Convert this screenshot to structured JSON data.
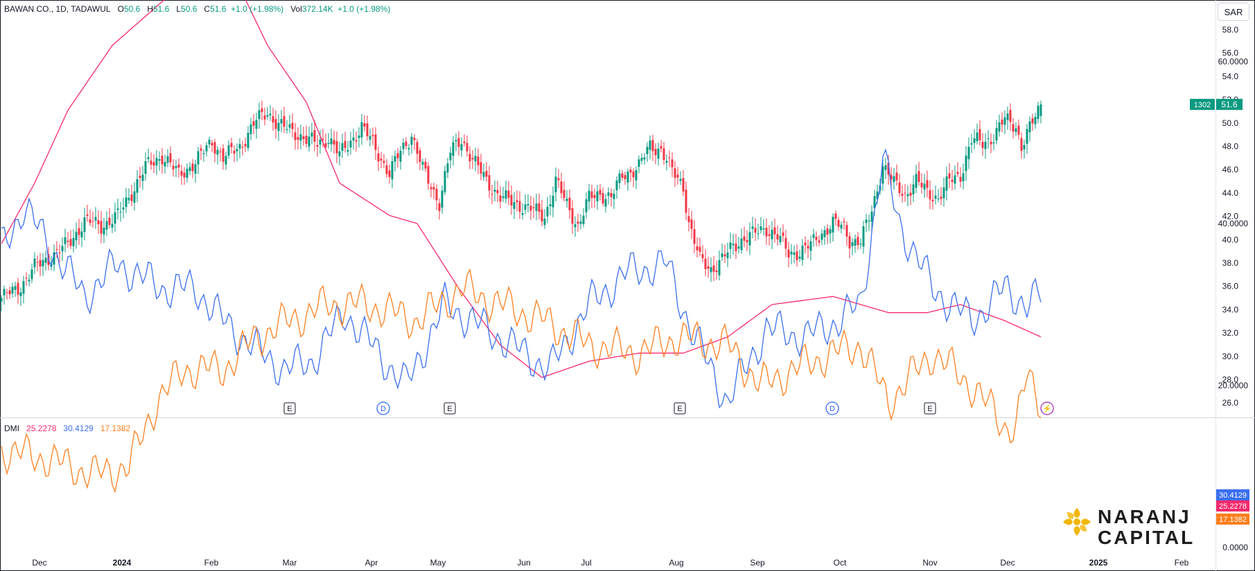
{
  "header": {
    "symbol": "BAWAN CO., 1D, TADAWUL",
    "o_label": "O",
    "o_value": "50.6",
    "h_label": "H",
    "h_value": "51.6",
    "l_label": "L",
    "l_value": "50.6",
    "c_label": "C",
    "c_value": "51.6",
    "change": "+1.0 (+1.98%)",
    "vol_label": "Vol",
    "vol_value": "372.14K",
    "vol_change": "+1.0 (+1.98%)"
  },
  "currency": "SAR",
  "dmi": {
    "label": "DMI",
    "v1": "25.2278",
    "v2": "30.4129",
    "v3": "17.1382"
  },
  "logo": {
    "line1": "NARANJ",
    "line2": "CAPITAL"
  },
  "colors": {
    "up": "#089981",
    "down": "#f23645",
    "adx": "#f7296d",
    "plus_di": "#3a6ff0",
    "minus_di": "#ff7f1e",
    "text": "#131722"
  },
  "chart_data": [
    {
      "type": "candlestick",
      "title": "BAWAN CO., 1D, TADAWUL",
      "y_ticks": [
        "58.0",
        "56.0",
        "54.0",
        "52.0",
        "50.0",
        "48.0",
        "46.0",
        "44.0",
        "42.0",
        "40.0",
        "38.0",
        "36.0",
        "34.0",
        "32.0",
        "30.0",
        "28.0",
        "26.0"
      ],
      "ylim": [
        25.2,
        59.0
      ],
      "x_ticks": [
        "Dec",
        "2024",
        "Feb",
        "Mar",
        "Apr",
        "May",
        "Jun",
        "Jul",
        "Aug",
        "Sep",
        "Oct",
        "Nov",
        "Dec",
        "2025",
        "Feb"
      ],
      "last_price": "51.6",
      "countdown": "1302",
      "close_path": [
        [
          0,
          35.0
        ],
        [
          6,
          35.8
        ],
        [
          12,
          37.6
        ],
        [
          18,
          38.6
        ],
        [
          24,
          39.6
        ],
        [
          30,
          41.6
        ],
        [
          36,
          41.2
        ],
        [
          42,
          42.0
        ],
        [
          48,
          44.5
        ],
        [
          52,
          46.2
        ],
        [
          58,
          47.2
        ],
        [
          64,
          45.6
        ],
        [
          70,
          46.6
        ],
        [
          76,
          48.5
        ],
        [
          80,
          47.0
        ],
        [
          86,
          48.0
        ],
        [
          92,
          50.2
        ],
        [
          96,
          51.0
        ],
        [
          100,
          49.8
        ],
        [
          106,
          49.2
        ],
        [
          110,
          48.6
        ],
        [
          114,
          48.2
        ],
        [
          118,
          48.8
        ],
        [
          122,
          47.2
        ],
        [
          126,
          48.5
        ],
        [
          130,
          49.6
        ],
        [
          134,
          48.3
        ],
        [
          140,
          45.6
        ],
        [
          144,
          47.6
        ],
        [
          148,
          49.0
        ],
        [
          152,
          46.0
        ],
        [
          158,
          43.2
        ],
        [
          162,
          47.5
        ],
        [
          166,
          48.7
        ],
        [
          170,
          46.8
        ],
        [
          176,
          44.8
        ],
        [
          180,
          43.6
        ],
        [
          186,
          43.1
        ],
        [
          192,
          42.5
        ],
        [
          196,
          42.0
        ],
        [
          200,
          45.0
        ],
        [
          204,
          43.0
        ],
        [
          208,
          41.2
        ],
        [
          212,
          43.5
        ],
        [
          216,
          44.0
        ],
        [
          220,
          43.6
        ],
        [
          224,
          45.5
        ],
        [
          230,
          46.3
        ],
        [
          234,
          48.0
        ],
        [
          238,
          47.8
        ],
        [
          242,
          45.8
        ],
        [
          246,
          44.6
        ],
        [
          248,
          41.5
        ],
        [
          252,
          38.2
        ],
        [
          256,
          37.5
        ],
        [
          260,
          38.3
        ],
        [
          264,
          39.4
        ],
        [
          268,
          40.2
        ],
        [
          272,
          40.5
        ],
        [
          276,
          41.0
        ],
        [
          280,
          40.3
        ],
        [
          284,
          38.8
        ],
        [
          288,
          39.0
        ],
        [
          292,
          39.5
        ],
        [
          296,
          40.6
        ],
        [
          300,
          41.4
        ],
        [
          304,
          41.0
        ],
        [
          306,
          40.0
        ],
        [
          310,
          39.8
        ],
        [
          314,
          42.5
        ],
        [
          318,
          46.4
        ],
        [
          322,
          44.8
        ],
        [
          326,
          43.9
        ],
        [
          330,
          45.0
        ],
        [
          334,
          44.1
        ],
        [
          338,
          43.6
        ],
        [
          342,
          45.0
        ],
        [
          346,
          45.6
        ],
        [
          350,
          48.5
        ],
        [
          354,
          48.3
        ],
        [
          358,
          48.9
        ],
        [
          362,
          50.3
        ],
        [
          366,
          49.8
        ],
        [
          368,
          48.0
        ],
        [
          372,
          50.0
        ],
        [
          375,
          51.6
        ]
      ],
      "events": [
        "E",
        "D",
        "E",
        "E",
        "D",
        "E",
        "⚡"
      ]
    },
    {
      "type": "line",
      "title": "DMI",
      "y_ticks": [
        "60.0000",
        "40.0000",
        "20.0000",
        "0.0000"
      ],
      "ylim": [
        -1.5,
        81.5
      ],
      "series": [
        {
          "name": "",
          "last": "25.2278",
          "values": [
            [
              0,
              37.5
            ],
            [
              12,
              45
            ],
            [
              24,
              54
            ],
            [
              40,
              62
            ],
            [
              60,
              68
            ],
            [
              82,
              72
            ],
            [
              96,
              62
            ],
            [
              110,
              55
            ],
            [
              122,
              45
            ],
            [
              140,
              41
            ],
            [
              150,
              40
            ],
            [
              165,
              32
            ],
            [
              180,
              25
            ],
            [
              195,
              21
            ],
            [
              212,
              23
            ],
            [
              230,
              24
            ],
            [
              246,
              24
            ],
            [
              262,
              26
            ],
            [
              278,
              30
            ],
            [
              300,
              31
            ],
            [
              320,
              29
            ],
            [
              334,
              29
            ],
            [
              346,
              30
            ],
            [
              362,
              28
            ],
            [
              375,
              26
            ]
          ]
        },
        {
          "name": "",
          "last": "30.4129",
          "values": [
            [
              0,
              37
            ],
            [
              8,
              42
            ],
            [
              20,
              36
            ],
            [
              30,
              31
            ],
            [
              42,
              35
            ],
            [
              58,
              32
            ],
            [
              70,
              32
            ],
            [
              80,
              28
            ],
            [
              90,
              25
            ],
            [
              102,
              22
            ],
            [
              112,
              23
            ],
            [
              124,
              29
            ],
            [
              136,
              24
            ],
            [
              146,
              20
            ],
            [
              160,
              30
            ],
            [
              170,
              28
            ],
            [
              184,
              25
            ],
            [
              198,
              22
            ],
            [
              212,
              30
            ],
            [
              226,
              34
            ],
            [
              240,
              35
            ],
            [
              250,
              26
            ],
            [
              262,
              18
            ],
            [
              276,
              27
            ],
            [
              290,
              26
            ],
            [
              302,
              28
            ],
            [
              310,
              30
            ],
            [
              318,
              48
            ],
            [
              324,
              40
            ],
            [
              336,
              32
            ],
            [
              350,
              28
            ],
            [
              362,
              32
            ],
            [
              370,
              30
            ],
            [
              375,
              31
            ]
          ]
        },
        {
          "name": "",
          "last": "17.1382",
          "values": [
            [
              0,
              12
            ],
            [
              16,
              11
            ],
            [
              34,
              9
            ],
            [
              46,
              10
            ],
            [
              56,
              18
            ],
            [
              66,
              22
            ],
            [
              80,
              22
            ],
            [
              92,
              26
            ],
            [
              104,
              28
            ],
            [
              118,
              30
            ],
            [
              132,
              30
            ],
            [
              150,
              28
            ],
            [
              166,
              32
            ],
            [
              180,
              30
            ],
            [
              196,
              28
            ],
            [
              212,
              25
            ],
            [
              230,
              24
            ],
            [
              244,
              26
            ],
            [
              262,
              25
            ],
            [
              274,
              20
            ],
            [
              286,
              22
            ],
            [
              300,
              24
            ],
            [
              310,
              25
            ],
            [
              320,
              18
            ],
            [
              336,
              24
            ],
            [
              350,
              20
            ],
            [
              362,
              15
            ],
            [
              366,
              15
            ],
            [
              370,
              21
            ],
            [
              375,
              18
            ]
          ]
        }
      ]
    }
  ]
}
